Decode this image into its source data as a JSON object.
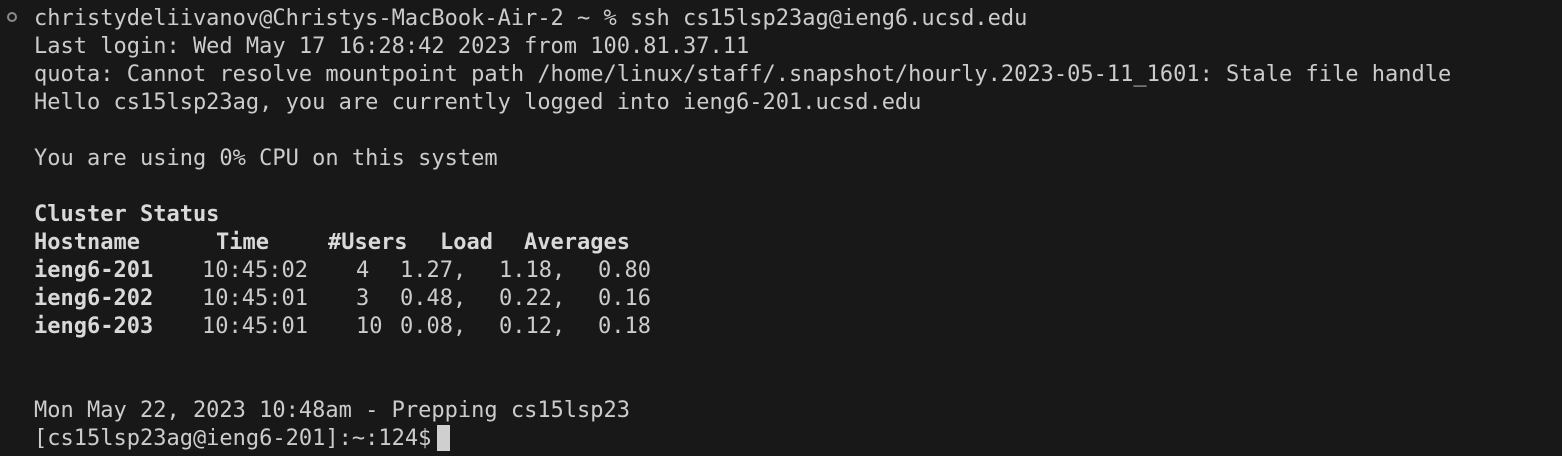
{
  "terminal": {
    "prompt_cmd": "christydeliivanov@Christys-MacBook-Air-2 ~ % ssh cs15lsp23ag@ieng6.ucsd.edu",
    "last_login": "Last login: Wed May 17 16:28:42 2023 from 100.81.37.11",
    "quota_msg": "quota: Cannot resolve mountpoint path /home/linux/staff/.snapshot/hourly.2023-05-11_1601: Stale file handle",
    "hello_msg": "Hello cs15lsp23ag, you are currently logged into ieng6-201.ucsd.edu",
    "cpu_msg": "You are using 0% CPU on this system",
    "cluster_title": "Cluster Status",
    "headers": {
      "hostname": "Hostname",
      "time": "Time",
      "users": "#Users",
      "load": "Load",
      "averages": "Averages"
    },
    "rows": [
      {
        "host": "ieng6-201",
        "time": "10:45:02",
        "users": "4",
        "l1": "1.27,",
        "l2": "1.18,",
        "l3": "0.80"
      },
      {
        "host": "ieng6-202",
        "time": "10:45:01",
        "users": "3",
        "l1": "0.48,",
        "l2": "0.22,",
        "l3": "0.16"
      },
      {
        "host": "ieng6-203",
        "time": "10:45:01",
        "users": "10",
        "l1": "0.08,",
        "l2": "0.12,",
        "l3": "0.18"
      }
    ],
    "prep_msg": "Mon May 22, 2023 10:48am - Prepping cs15lsp23",
    "prompt": "[cs15lsp23ag@ieng6-201]:~:124$"
  },
  "colors": {
    "background": "#181818",
    "text": "#cccccc",
    "bold_text": "#d9d9d9",
    "cursor": "#cfcfcf"
  }
}
